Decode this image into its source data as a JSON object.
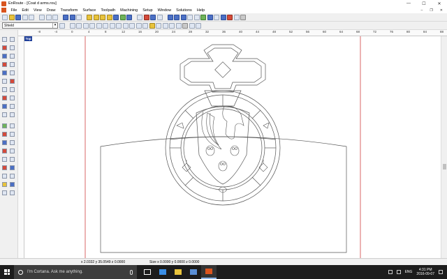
{
  "window": {
    "title": "EnRoute - [Coat d arms.rou]",
    "minimize_glyph": "—",
    "maximize_glyph": "☐",
    "close_glyph": "✕"
  },
  "menubar": {
    "items": [
      "File",
      "Edit",
      "View",
      "Draw",
      "Transform",
      "Surface",
      "Toolpath",
      "Machining",
      "Setup",
      "Window",
      "Solutions",
      "Help"
    ],
    "mdi_minimize": "–",
    "mdi_restore": "❐",
    "mdi_close": "✕"
  },
  "toolbar": {
    "layer_select_value": "Shield"
  },
  "ruler": {
    "top_ticks": [
      "-8",
      "-4",
      "0",
      "4",
      "8",
      "12",
      "16",
      "20",
      "24",
      "28",
      "32",
      "36",
      "40",
      "44",
      "48",
      "52",
      "56",
      "60",
      "64",
      "68",
      "72",
      "76",
      "80",
      "84",
      "88"
    ]
  },
  "view_badge": "Top",
  "statusbar": {
    "coords": "x 2.0332 y 35.0549 z 0.0000",
    "size": "Size x 0.0000 y 0.0000 z 0.0000"
  },
  "taskbar": {
    "search_placeholder": "I'm Cortana. Ask me anything.",
    "language": "ENG",
    "time": "4:31 PM",
    "date": "2016-09-07"
  }
}
